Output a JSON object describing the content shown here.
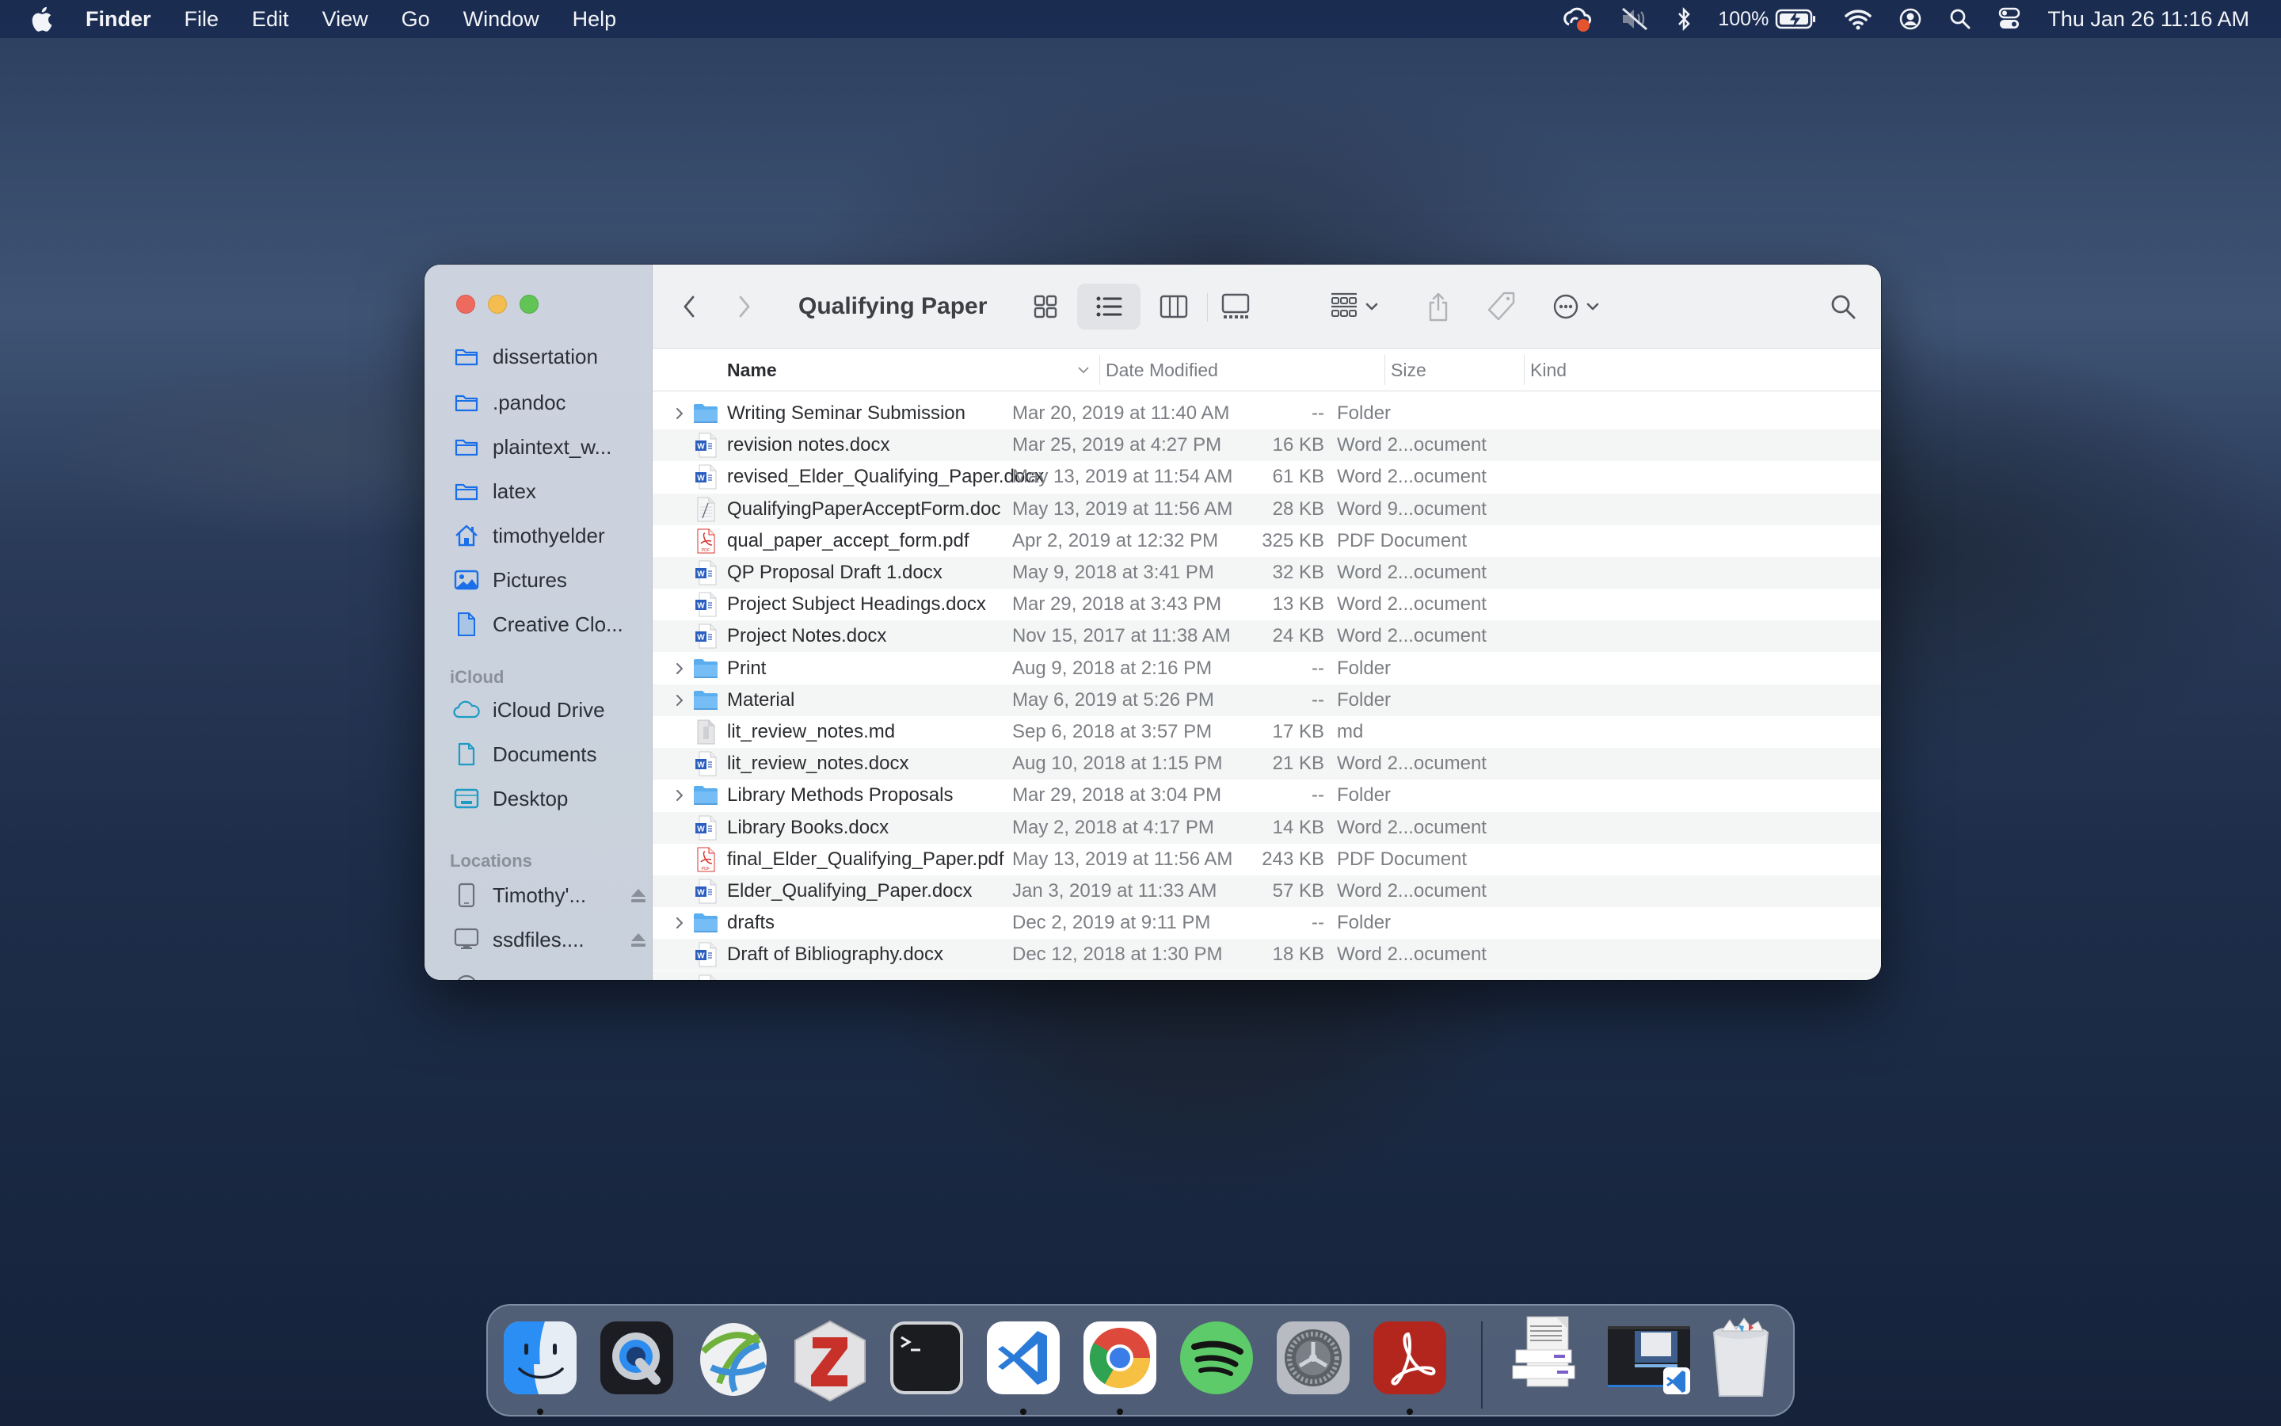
{
  "menubar": {
    "app_name": "Finder",
    "menus": [
      "File",
      "Edit",
      "View",
      "Go",
      "Window",
      "Help"
    ],
    "status": {
      "battery_percent": "100%",
      "clock": "Thu Jan 26  11:16 AM"
    }
  },
  "window": {
    "title": "Qualifying Paper",
    "sidebar": {
      "favorites": [
        {
          "label": "dissertation",
          "icon": "folder-icon"
        },
        {
          "label": ".pandoc",
          "icon": "folder-icon"
        },
        {
          "label": "plaintext_w...",
          "icon": "folder-icon"
        },
        {
          "label": "latex",
          "icon": "folder-icon"
        },
        {
          "label": "timothyelder",
          "icon": "home-icon"
        },
        {
          "label": "Pictures",
          "icon": "pictures-icon"
        },
        {
          "label": "Creative Clo...",
          "icon": "document-icon"
        }
      ],
      "icloud_header": "iCloud",
      "icloud": [
        {
          "label": "iCloud Drive",
          "icon": "cloud-icon"
        },
        {
          "label": "Documents",
          "icon": "document-icon"
        },
        {
          "label": "Desktop",
          "icon": "desktop-icon"
        }
      ],
      "locations_header": "Locations",
      "locations": [
        {
          "label": "Timothy'...",
          "icon": "ipad-icon",
          "eject": true
        },
        {
          "label": "ssdfiles....",
          "icon": "monitor-icon",
          "eject": true
        }
      ]
    },
    "toolbar": {
      "views": [
        "icon-view",
        "list-view",
        "column-view",
        "gallery-view"
      ],
      "active_view": "list-view"
    },
    "columns": {
      "name": "Name",
      "date": "Date Modified",
      "size": "Size",
      "kind": "Kind"
    },
    "files": [
      {
        "name": "Writing Seminar Submission",
        "date": "Mar 20, 2019 at 11:40 AM",
        "size": "--",
        "kind": "Folder",
        "type": "folder"
      },
      {
        "name": "revision notes.docx",
        "date": "Mar 25, 2019 at 4:27 PM",
        "size": "16 KB",
        "kind": "Word 2...ocument",
        "type": "word"
      },
      {
        "name": "revised_Elder_Qualifying_Paper.docx",
        "date": "May 13, 2019 at 11:54 AM",
        "size": "61 KB",
        "kind": "Word 2...ocument",
        "type": "word"
      },
      {
        "name": "QualifyingPaperAcceptForm.doc",
        "date": "May 13, 2019 at 11:56 AM",
        "size": "28 KB",
        "kind": "Word 9...ocument",
        "type": "doc"
      },
      {
        "name": "qual_paper_accept_form.pdf",
        "date": "Apr 2, 2019 at 12:32 PM",
        "size": "325 KB",
        "kind": "PDF Document",
        "type": "pdf"
      },
      {
        "name": "QP Proposal Draft 1.docx",
        "date": "May 9, 2018 at 3:41 PM",
        "size": "32 KB",
        "kind": "Word 2...ocument",
        "type": "word"
      },
      {
        "name": "Project Subject Headings.docx",
        "date": "Mar 29, 2018 at 3:43 PM",
        "size": "13 KB",
        "kind": "Word 2...ocument",
        "type": "word"
      },
      {
        "name": "Project Notes.docx",
        "date": "Nov 15, 2017 at 11:38 AM",
        "size": "24 KB",
        "kind": "Word 2...ocument",
        "type": "word"
      },
      {
        "name": "Print",
        "date": "Aug 9, 2018 at 2:16 PM",
        "size": "--",
        "kind": "Folder",
        "type": "folder"
      },
      {
        "name": "Material",
        "date": "May 6, 2019 at 5:26 PM",
        "size": "--",
        "kind": "Folder",
        "type": "folder"
      },
      {
        "name": "lit_review_notes.md",
        "date": "Sep 6, 2018 at 3:57 PM",
        "size": "17 KB",
        "kind": "md",
        "type": "md"
      },
      {
        "name": "lit_review_notes.docx",
        "date": "Aug 10, 2018 at 1:15 PM",
        "size": "21 KB",
        "kind": "Word 2...ocument",
        "type": "word"
      },
      {
        "name": "Library Methods Proposals",
        "date": "Mar 29, 2018 at 3:04 PM",
        "size": "--",
        "kind": "Folder",
        "type": "folder"
      },
      {
        "name": "Library Books.docx",
        "date": "May 2, 2018 at 4:17 PM",
        "size": "14 KB",
        "kind": "Word 2...ocument",
        "type": "word"
      },
      {
        "name": "final_Elder_Qualifying_Paper.pdf",
        "date": "May 13, 2019 at 11:56 AM",
        "size": "243 KB",
        "kind": "PDF Document",
        "type": "pdf"
      },
      {
        "name": "Elder_Qualifying_Paper.docx",
        "date": "Jan 3, 2019 at 11:33 AM",
        "size": "57 KB",
        "kind": "Word 2...ocument",
        "type": "word"
      },
      {
        "name": "drafts",
        "date": "Dec 2, 2019 at 9:11 PM",
        "size": "--",
        "kind": "Folder",
        "type": "folder"
      },
      {
        "name": "Draft of Bibliography.docx",
        "date": "Dec 12, 2018 at 1:30 PM",
        "size": "18 KB",
        "kind": "Word 2...ocument",
        "type": "word"
      }
    ]
  },
  "dock": {
    "apps": [
      {
        "name": "Finder",
        "running": true
      },
      {
        "name": "QuickTime Player",
        "running": false
      },
      {
        "name": "Cisco AnyConnect",
        "running": false
      },
      {
        "name": "Zotero",
        "running": false
      },
      {
        "name": "Terminal",
        "running": false
      },
      {
        "name": "Visual Studio Code",
        "running": true
      },
      {
        "name": "Google Chrome",
        "running": true
      },
      {
        "name": "Spotify",
        "running": false
      },
      {
        "name": "System Preferences",
        "running": false
      },
      {
        "name": "Adobe Acrobat",
        "running": true
      }
    ],
    "others": [
      "Documents stack",
      "Visual Studio Code window",
      "Trash"
    ]
  }
}
